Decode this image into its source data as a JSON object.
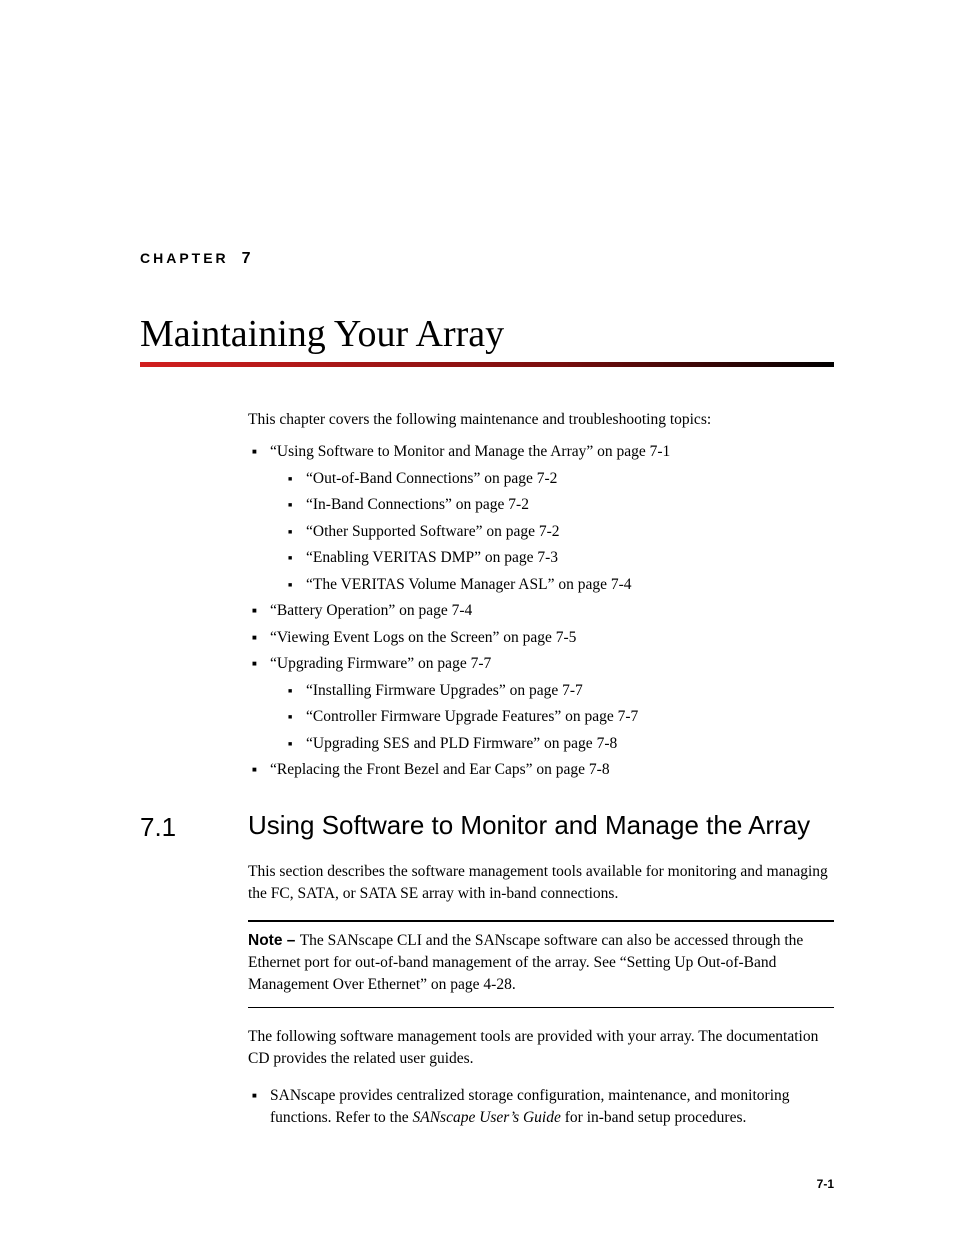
{
  "chapter": {
    "label": "CHAPTER",
    "number": "7",
    "title": "Maintaining Your Array"
  },
  "intro": "This chapter covers the following maintenance and troubleshooting topics:",
  "toc": [
    {
      "text": "“Using Software to Monitor and Manage the Array” on page 7-1",
      "children": [
        "“Out-of-Band Connections” on page 7-2",
        "“In-Band Connections” on page 7-2",
        "“Other Supported Software” on page 7-2",
        "“Enabling VERITAS DMP” on page 7-3",
        "“The VERITAS Volume Manager ASL” on page 7-4"
      ]
    },
    {
      "text": "“Battery Operation” on page 7-4"
    },
    {
      "text": "“Viewing Event Logs on the Screen” on page 7-5"
    },
    {
      "text": "“Upgrading Firmware” on page 7-7",
      "children": [
        "“Installing Firmware Upgrades” on page 7-7",
        "“Controller Firmware Upgrade Features” on page 7-7",
        "“Upgrading SES and PLD Firmware” on page 7-8"
      ]
    },
    {
      "text": "“Replacing the Front Bezel and Ear Caps” on page 7-8"
    }
  ],
  "section": {
    "number": "7.1",
    "title": "Using Software to Monitor and Manage the Array",
    "para1": "This section describes the software management tools available for monitoring and managing the FC, SATA, or SATA SE array with in-band connections.",
    "note_label": "Note – ",
    "note_body": "The SANscape CLI and the SANscape software can also be accessed through the Ethernet port for out-of-band management of the array. See  “Setting Up Out-of-Band Management Over Ethernet” on page 4-28.",
    "para2": "The following software management tools are provided with your array. The documentation CD provides the related user guides.",
    "bullet_pre": "SANscape provides centralized storage configuration, maintenance, and monitoring functions. Refer to the ",
    "bullet_italic": "SANscape User’s Guide",
    "bullet_post": " for in-band setup procedures."
  },
  "page_number": "7-1"
}
